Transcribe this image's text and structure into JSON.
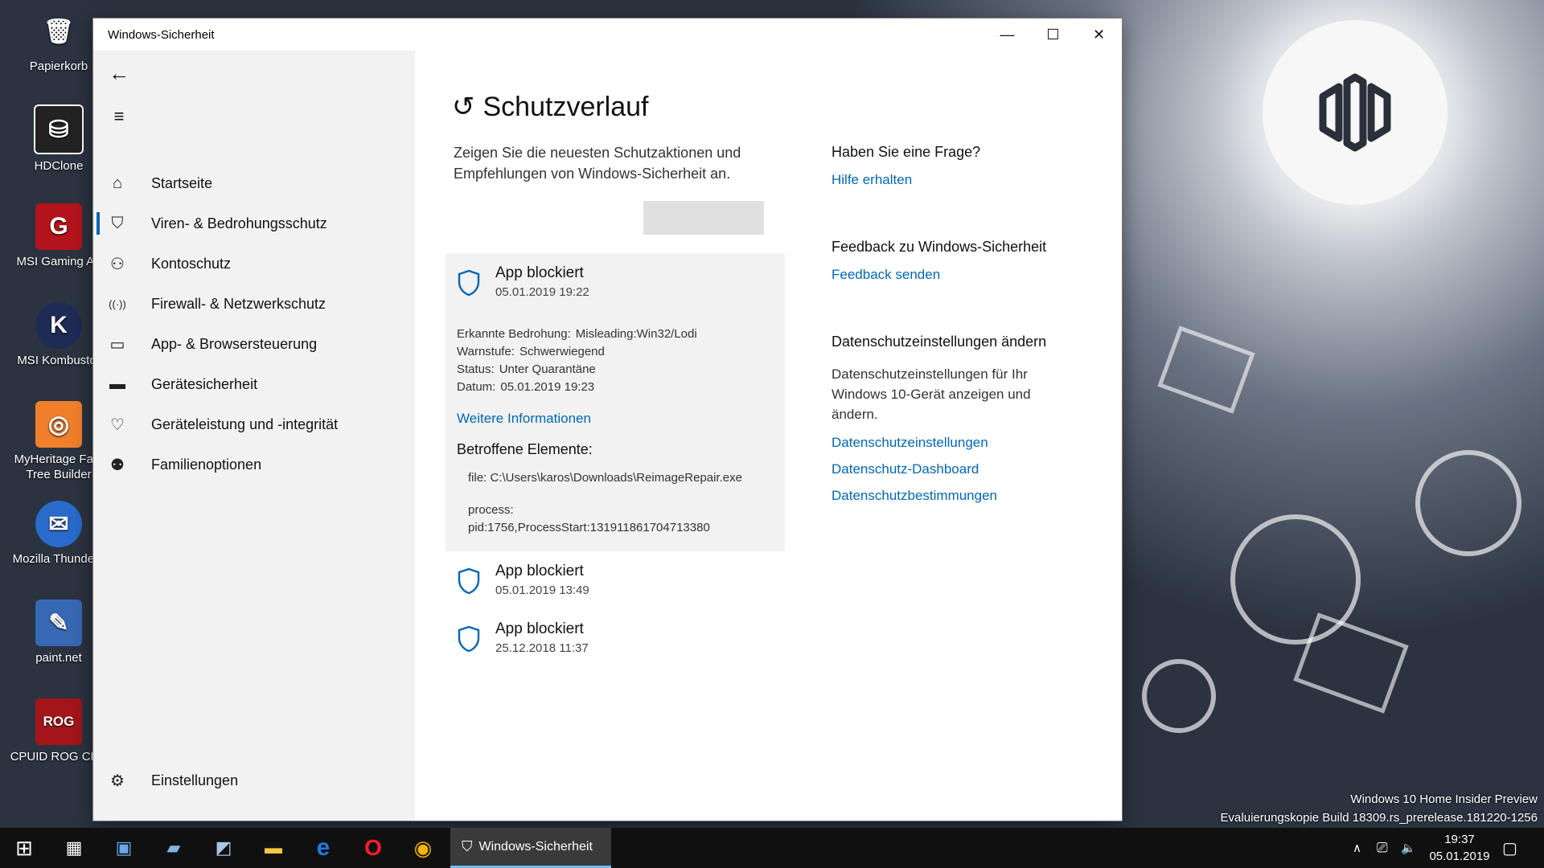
{
  "desktop": {
    "icons": [
      {
        "label": "Papierkorb",
        "glyph": "🗑",
        "color": "#9aa6b5"
      },
      {
        "label": "HDClone",
        "glyph": "⛁",
        "color": "#222222"
      },
      {
        "label": "MSI Gaming Ap",
        "glyph": "G",
        "color": "#b3141b"
      },
      {
        "label": "MSI Kombustor",
        "glyph": "K",
        "color": "#1d2b55"
      },
      {
        "label": "MyHeritage Fam",
        "label2": "Tree Builder",
        "glyph": "◎",
        "color": "#f07f2b"
      },
      {
        "label": "Mozilla Thunderb",
        "glyph": "✉",
        "color": "#2a6acb"
      },
      {
        "label": "paint.net",
        "glyph": "✎",
        "color": "#3768b3"
      },
      {
        "label": "CPUID ROG CPU",
        "glyph": "ROG",
        "color": "#a3151a"
      }
    ],
    "watermark_line1": "Windows 10 Home Insider Preview",
    "watermark_line2": "Evaluierungskopie Build 18309.rs_prerelease.181220-1256"
  },
  "window": {
    "title": "Windows-Sicherheit",
    "minimize": "—",
    "maximize": "☐",
    "close": "✕"
  },
  "sidebar": {
    "back_glyph": "←",
    "menu_glyph": "≡",
    "items": [
      {
        "label": "Startseite",
        "icon": "⌂"
      },
      {
        "label": "Viren- & Bedrohungsschutz",
        "icon": "⛉"
      },
      {
        "label": "Kontoschutz",
        "icon": "⚇"
      },
      {
        "label": "Firewall- & Netzwerkschutz",
        "icon": "((·))"
      },
      {
        "label": "App- & Browsersteuerung",
        "icon": "▭"
      },
      {
        "label": "Gerätesicherheit",
        "icon": "▬"
      },
      {
        "label": "Geräteleistung und -integrität",
        "icon": "♡"
      },
      {
        "label": "Familienoptionen",
        "icon": "⚉"
      }
    ],
    "settings_label": "Einstellungen",
    "settings_icon": "⚙"
  },
  "main": {
    "title": "Schutzverlauf",
    "title_icon": "↺",
    "description": "Zeigen Sie die neuesten Schutzaktionen und Empfehlungen von Windows-Sicherheit an.",
    "entries": [
      {
        "title": "App blockiert",
        "date": "05.01.2019 19:22",
        "details": [
          {
            "key": "Erkannte Bedrohung:",
            "value": "Misleading:Win32/Lodi"
          },
          {
            "key": "Warnstufe:",
            "value": "Schwerwiegend"
          },
          {
            "key": "Status:",
            "value": "Unter Quarantäne"
          },
          {
            "key": "Datum:",
            "value": "05.01.2019 19:23"
          }
        ],
        "more_link": "Weitere Informationen",
        "affected_heading": "Betroffene Elemente:",
        "affected_file": "file: C:\\Users\\karos\\Downloads\\ReimageRepair.exe",
        "affected_process_label": "process:",
        "affected_process_value": "pid:1756,ProcessStart:131911861704713380"
      },
      {
        "title": "App blockiert",
        "date": "05.01.2019 13:49"
      },
      {
        "title": "App blockiert",
        "date": "25.12.2018 11:37"
      }
    ]
  },
  "right": {
    "question_heading": "Haben Sie eine Frage?",
    "help_link": "Hilfe erhalten",
    "feedback_heading": "Feedback zu Windows-Sicherheit",
    "feedback_link": "Feedback senden",
    "privacy_heading": "Datenschutzeinstellungen ändern",
    "privacy_text": "Datenschutzeinstellungen für Ihr Windows 10-Gerät anzeigen und ändern.",
    "privacy_links": [
      "Datenschutzeinstellungen",
      "Datenschutz-Dashboard",
      "Datenschutzbestimmungen"
    ]
  },
  "taskbar": {
    "start_glyph": "⊞",
    "pinned": [
      {
        "name": "calendar",
        "glyph": "▦",
        "color": "#ffffff"
      },
      {
        "name": "contacts",
        "glyph": "▣",
        "color": "#6aa6e8"
      },
      {
        "name": "photos",
        "glyph": "▰",
        "color": "#7fb5e6"
      },
      {
        "name": "notes",
        "glyph": "◩",
        "color": "#a9c6e6"
      },
      {
        "name": "explorer",
        "glyph": "▬",
        "color": "#f3c744"
      },
      {
        "name": "edge",
        "glyph": "e",
        "color": "#1f7ae0"
      },
      {
        "name": "opera",
        "glyph": "O",
        "color": "#ff1b2d"
      },
      {
        "name": "chrome",
        "glyph": "◉",
        "color": "#f2b400"
      }
    ],
    "active_app": "Windows-Sicherheit",
    "active_icon": "⛉",
    "tray_chevron": "∧",
    "tray_network": "⎚",
    "tray_volume": "🔈",
    "time": "19:37",
    "date": "05.01.2019",
    "notification_glyph": "▢"
  }
}
